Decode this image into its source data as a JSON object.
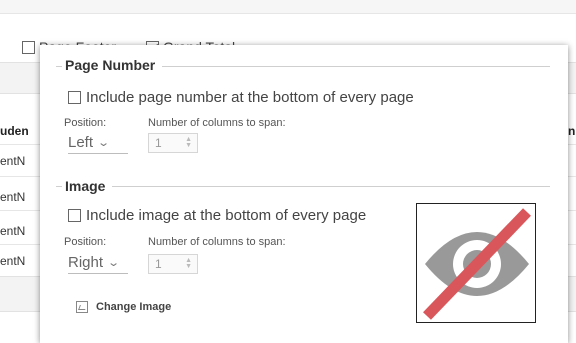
{
  "background": {
    "options": {
      "page_footer": {
        "label": "Page Footer",
        "checked": false
      },
      "grand_total": {
        "label": "Grand Total",
        "checked": true
      }
    },
    "table": {
      "left_header": "uden",
      "right_header": "n",
      "left_cells": [
        "entN",
        "entN",
        "entN",
        "entN"
      ]
    }
  },
  "panel": {
    "page_number": {
      "title": "Page Number",
      "include_label": "Include page number at the bottom of every page",
      "include_checked": false,
      "position_label": "Position:",
      "position_value": "Left",
      "columns_label": "Number of columns to span:",
      "columns_value": "1"
    },
    "image": {
      "title": "Image",
      "include_label": "Include image at the bottom of every page",
      "include_checked": false,
      "position_label": "Position:",
      "position_value": "Right",
      "columns_label": "Number of columns to span:",
      "columns_value": "1",
      "preview_icon": "eye-slash-icon",
      "change_image_label": "Change Image"
    }
  },
  "colors": {
    "eye_gray": "#999999",
    "slash_red": "#d9575b",
    "panel_border": "#222222"
  }
}
